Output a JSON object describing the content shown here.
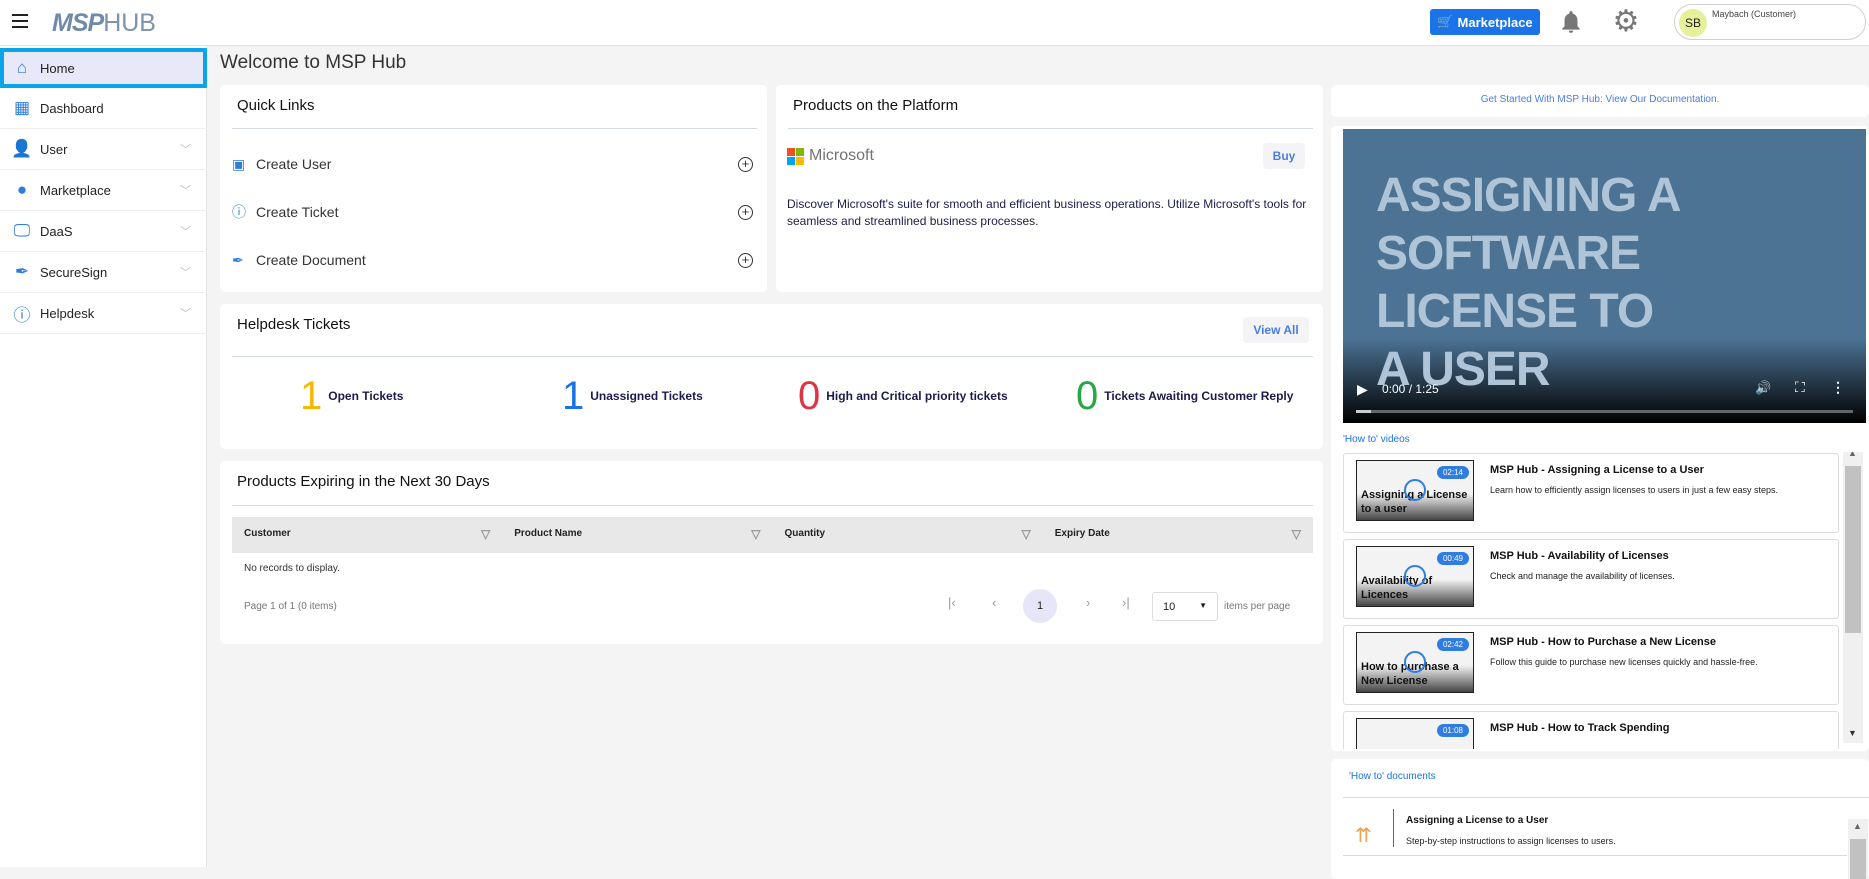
{
  "header": {
    "logo": "MSPHUB",
    "logo_a": "MSP",
    "logo_b": "HUB",
    "marketplace": "Marketplace",
    "user_initials": "SB",
    "user_name": "Maybach (Customer)",
    "brand_color": "#1a73e8"
  },
  "sidebar": {
    "items": [
      {
        "label": "Home",
        "icon": "home-icon",
        "active": true
      },
      {
        "label": "Dashboard",
        "icon": "dashboard-icon"
      },
      {
        "label": "User",
        "icon": "user-gear-icon",
        "chevron": true
      },
      {
        "label": "Marketplace",
        "icon": "store-icon",
        "chevron": true
      },
      {
        "label": "DaaS",
        "icon": "monitor-icon",
        "chevron": true
      },
      {
        "label": "SecureSign",
        "icon": "pen-icon",
        "chevron": true
      },
      {
        "label": "Helpdesk",
        "icon": "help-icon",
        "chevron": true
      }
    ]
  },
  "main": {
    "title": "Welcome to MSP Hub",
    "quick_links": {
      "title": "Quick Links",
      "items": [
        {
          "label": "Create User",
          "icon": "user-card-icon"
        },
        {
          "label": "Create Ticket",
          "icon": "question-icon"
        },
        {
          "label": "Create Document",
          "icon": "pen-icon"
        }
      ]
    },
    "products": {
      "title": "Products on the Platform",
      "vendor": "Microsoft",
      "buy": "Buy",
      "description": "Discover Microsoft's suite for smooth and efficient business operations. Utilize Microsoft's tools for seamless and streamlined business processes."
    },
    "helpdesk": {
      "title": "Helpdesk Tickets",
      "view_all": "View All",
      "stats": [
        {
          "value": "1",
          "label": "Open Tickets",
          "color": "#f5b800"
        },
        {
          "value": "1",
          "label": "Unassigned Tickets",
          "color": "#1a73e8"
        },
        {
          "value": "0",
          "label": "High and Critical priority tickets",
          "color": "#dc3545"
        },
        {
          "value": "0",
          "label": "Tickets Awaiting Customer Reply",
          "color": "#28a745"
        }
      ]
    },
    "expiring": {
      "title": "Products Expiring in the Next 30 Days",
      "columns": [
        "Customer",
        "Product Name",
        "Quantity",
        "Expiry Date"
      ],
      "empty": "No records to display.",
      "page_info": "Page 1 of 1 (0 items)",
      "current_page": "1",
      "page_size": "10",
      "per_page_label": "items per page"
    }
  },
  "right": {
    "doc_link": "Get Started With MSP Hub: View Our Documentation.",
    "video": {
      "line1": "ASSIGNING A",
      "line2": "SOFTWARE",
      "line3": "LICENSE TO",
      "line4": "A USER",
      "time": "0:00 / 1:25"
    },
    "videos_title": "'How to' videos",
    "videos": [
      {
        "title": "MSP Hub - Assigning a License to a User",
        "desc": "Learn how to efficiently assign licenses to users in just a few easy steps.",
        "duration": "02:14",
        "thumb": "Assigning a License to a user"
      },
      {
        "title": "MSP Hub - Availability of Licenses",
        "desc": "Check and manage the availability of licenses.",
        "duration": "00:49",
        "thumb": "Availability of Licences"
      },
      {
        "title": "MSP Hub - How to Purchase a New License",
        "desc": "Follow this guide to purchase new licenses quickly and hassle-free.",
        "duration": "02:42",
        "thumb": "How to purchase a New License"
      },
      {
        "title": "MSP Hub - How to Track Spending",
        "desc": "",
        "duration": "01:08",
        "thumb": ""
      }
    ],
    "docs_title": "'How to' documents",
    "docs": [
      {
        "title": "Assigning a License to a User",
        "desc": "Step-by-step instructions to assign licenses to users."
      }
    ]
  }
}
